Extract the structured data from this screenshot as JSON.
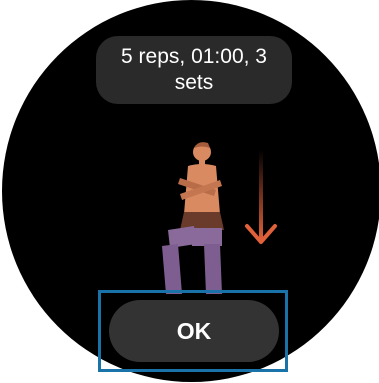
{
  "summary": {
    "text": "5 reps, 01:00, 3 sets"
  },
  "exercise_illustration": {
    "icon": "squat-figure-icon",
    "arrow_icon": "down-arrow-icon"
  },
  "actions": {
    "ok_label": "OK"
  },
  "colors": {
    "background": "#000000",
    "pill": "#2a2a2a",
    "button": "#333333",
    "highlight": "#1a73a8",
    "figure_body": "#d98a60",
    "figure_legs": "#8a6a9a",
    "arrow": "#e0613a"
  }
}
